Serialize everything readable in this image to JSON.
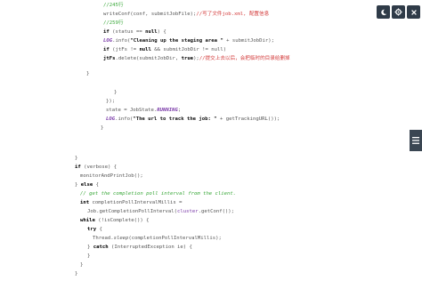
{
  "code": {
    "l1": "//245行",
    "l2a": "writeConf(conf, submitJobFile);",
    "l2b": "//写了文件job.xml, 配置信息",
    "l3": "//259行",
    "l4a": "if",
    "l4b": " (status == ",
    "l4c": "null",
    "l4d": ") {",
    "l5a": "LOG",
    "l5b": ".info(",
    "l5c": "\"Cleaning up the staging area \"",
    "l5d": " + submitJobDir);",
    "l6a": "if",
    "l6b": " (jtFs != ",
    "l6c": "null",
    "l6d": " && submitJobDir != null)",
    "l7a": "jtFs",
    "l7b": ".delete(submitJobDir, ",
    "l7c": "true",
    "l7d": ");",
    "l7e": "//提交上去以后，会把临时的目录给删掉",
    "l8": "}",
    "l9": "}",
    "l10": "});",
    "l11a": "state = JobState.",
    "l11b": "RUNNING",
    "l11c": ";",
    "l12a": "LOG",
    "l12b": ".info(",
    "l12c": "\"The url to track the job: \"",
    "l12d": " + getTrackingURL());",
    "l13": "}",
    "l14": "}",
    "l15a": "if",
    "l15b": " (verbose) {",
    "l16": "monitorAndPrintJob();",
    "l17a": "} ",
    "l17b": "else",
    "l17c": " {",
    "l18": "// get the completion poll interval from the client.",
    "l19a": "int",
    "l19b": " completionPollIntervalMillis =",
    "l20a": "Job.getCompletionPollInterval(",
    "l20b": "cluster",
    "l20c": ".getConf());",
    "l21a": "while",
    "l21b": " (!isComplete()) {",
    "l22a": "try",
    "l22b": " {",
    "l23a": "Thread.",
    "l23b": "sleep",
    "l23c": "(completionPollIntervalMillis);",
    "l24a": "} ",
    "l24b": "catch",
    "l24c": " (InterruptedException ie) {",
    "l25": "}",
    "l26": "}",
    "l27": "}"
  },
  "toolbar": {
    "moon_icon": "moon-icon",
    "gear_icon": "gear-icon",
    "close_icon": "close-icon"
  },
  "sidebar": {
    "icon": "list-icon"
  },
  "colors": {
    "button_bg": "#2f3b48",
    "comment_green": "#3aa83a",
    "comment_red": "#d33a3a",
    "static_purple": "#7a3aa8"
  }
}
